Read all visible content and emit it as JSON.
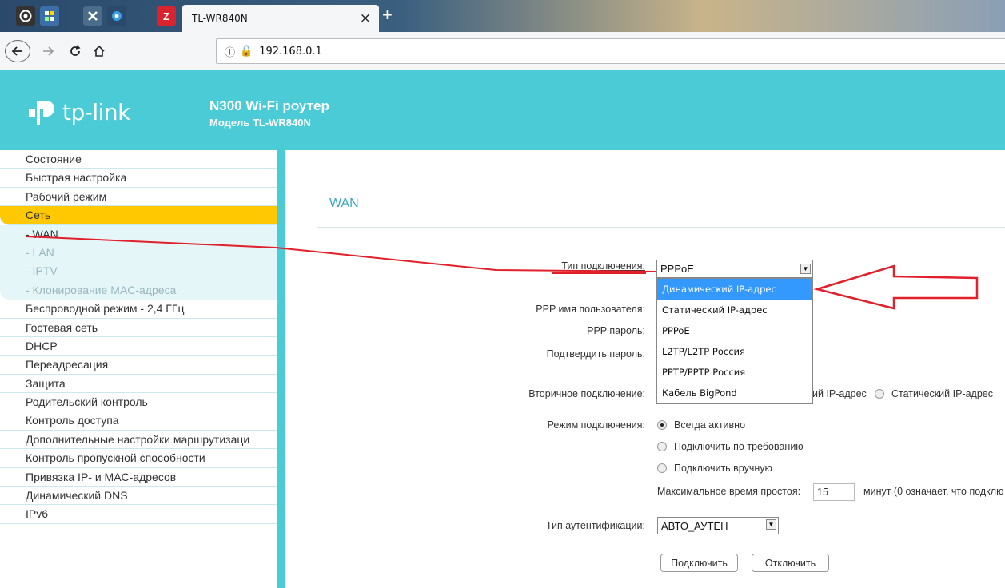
{
  "browser": {
    "tab_title": "TL-WR840N",
    "tab_close": "×",
    "new_tab": "+",
    "pinned_z": "Z",
    "url": "192.168.0.1",
    "icons": [
      "firefox-icon",
      "app-grid-icon",
      "addon-icon",
      "gear-icon",
      "zotero-icon"
    ]
  },
  "header": {
    "logo_text": "tp-link",
    "product_title": "N300 Wi-Fi роутер",
    "product_model": "Модель TL-WR840N",
    "bg_color": "#4acbd6"
  },
  "sidebar": {
    "items_top": [
      "Состояние",
      "Быстрая настройка",
      "Рабочий режим"
    ],
    "active_item": "Сеть",
    "sub_items": [
      "- WAN",
      "- LAN",
      "- IPTV",
      "- Клонирование MAC-адреса"
    ],
    "items_bottom": [
      "Беспроводной режим - 2,4 ГГц",
      "Гостевая сеть",
      "DHCP",
      "Переадресация",
      "Защита",
      "Родительский контроль",
      "Контроль доступа",
      "Дополнительные настройки маршрутизаци",
      "Контроль пропускной способности",
      "Привязка IP- и MAC-адресов",
      "Динамический DNS",
      "IPv6"
    ]
  },
  "main": {
    "title": "WAN",
    "labels": {
      "conn_type": "Тип подключения:",
      "ppp_user": "PPP имя пользователя:",
      "ppp_pass": "PPP пароль:",
      "confirm_pass": "Подтвердить пароль:",
      "secondary": "Вторичное подключение:",
      "conn_mode": "Режим подключения:",
      "auth_type": "Тип аутентификации:"
    },
    "conn_type_value": "PPPoE",
    "dropdown_options": [
      "Динамический IP-адрес",
      "Статический IP-адрес",
      "PPPoE",
      "L2TP/L2TP Россия",
      "PPTP/PPTP Россия",
      "Кабель BigPond"
    ],
    "secondary_partial": "ий IP-адрес",
    "secondary_static": "Статический IP-адрес",
    "mode_options": [
      "Всегда активно",
      "Подключить по требованию",
      "Подключить вручную"
    ],
    "idle_label": "Максимальное время простоя:",
    "idle_value": "15",
    "idle_suffix": "минут (0 означает, что подклю",
    "auth_value": "АВТО_АУТЕН",
    "connect_btn": "Подключить",
    "disconnect_btn": "Отключить"
  }
}
